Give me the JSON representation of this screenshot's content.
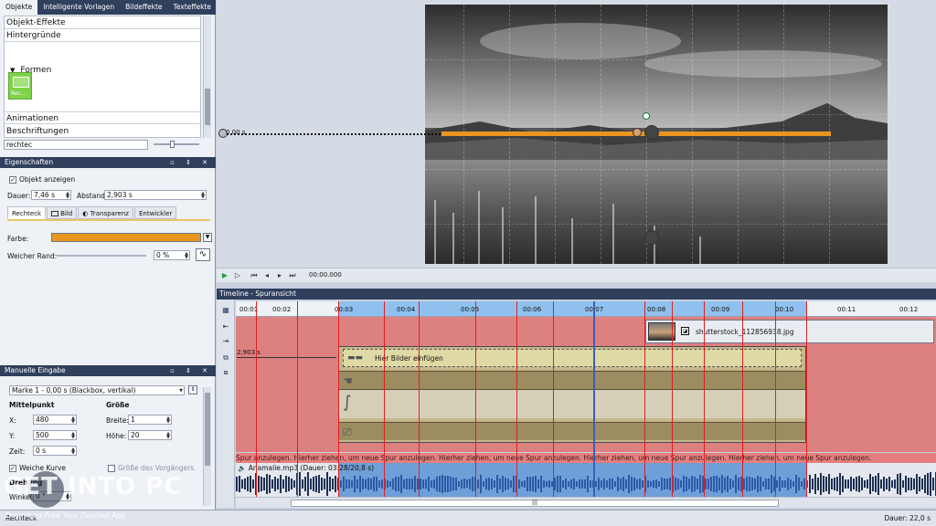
{
  "panel_tabs": [
    "Objekte",
    "Intelligente Vorlagen",
    "Bildeffekte",
    "Texteffekte"
  ],
  "objects": {
    "categories": [
      "Objekt-Effekte",
      "Hintergründe",
      "Formen",
      "Animationen",
      "Beschriftungen"
    ],
    "tile_label": "Rec...",
    "search_value": "rechtec"
  },
  "properties": {
    "title": "Eigenschaften",
    "show_object": "Objekt anzeigen",
    "duration_label": "Dauer:",
    "duration_value": "7,46 s",
    "spacing_label": "Abstand:",
    "spacing_value": "2,903 s",
    "tabs": [
      "Rechteck",
      "Bild",
      "Transparenz",
      "Entwickler"
    ],
    "color_label": "Farbe:",
    "color_value": "#e8961f",
    "soft_edge_label": "Weicher Rand:",
    "soft_edge_value": "0 %"
  },
  "manual": {
    "title": "Manuelle Eingabe",
    "marker_value": "Marke 1 - 0,00 s (Blackbox, vertikal)",
    "center_title": "Mittelpunkt",
    "size_title": "Größe",
    "x_label": "X:",
    "x_value": "480",
    "y_label": "Y:",
    "y_value": "500",
    "time_label": "Zeit:",
    "time_value": "0 s",
    "width_label": "Breite:",
    "width_value": "1",
    "height_label": "Höhe:",
    "height_value": "20",
    "soft_curve": "Weiche Kurve",
    "next_label": "Größe des Vorgängers",
    "rotation_title": "Drehung",
    "angle_label": "Winkel:",
    "angle_value": "0 °"
  },
  "preview": {
    "coord_readout": "0,00 s",
    "timecode": "00:00.000"
  },
  "timeline": {
    "title": "Timeline - Spuransicht",
    "ticks": [
      "00:01",
      "00:02",
      "00:03",
      "00:04",
      "00:05",
      "00:06",
      "00:07",
      "00:08",
      "00:09",
      "00:10",
      "00:11",
      "00:12"
    ],
    "image_clip": "shutterstock_112856938.jpg",
    "blackbox_text": "Hier Bilder einfügen",
    "offset_label": "2,903 s",
    "hint_text": "Spur anzulegen.    Hierher ziehen, um neue Spur anzulegen.    Hierher ziehen, um neue Spur anzulegen.    Hierher ziehen, um neue Spur anzulegen.    Hierher ziehen, um neue Spur anzulegen.",
    "audio_label": "Anamalie.mp3 (Dauer: 03:28/20,8 s)"
  },
  "status": {
    "left": "Rechteck",
    "right": "Dauer: 22,0 s"
  },
  "watermark": {
    "logo": "GET INTO PC",
    "tagline": "Download Free Your Desired App"
  },
  "colors": {
    "accent": "#e8961f",
    "panel_header": "#2f3f5c",
    "timeline_bg": "#dd8080",
    "selection": "#8fc0ee"
  }
}
